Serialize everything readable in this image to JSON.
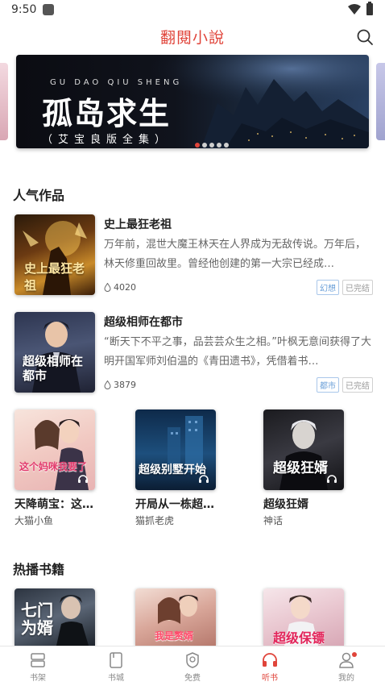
{
  "status_bar": {
    "time": "9:50"
  },
  "header": {
    "title": "翻閱小說",
    "search_icon": "search-icon"
  },
  "banner": {
    "pinyin": "GU DAO QIU SHENG",
    "title": "孤岛求生",
    "subtitle": "（艾宝良版全集）",
    "dot_count": 5,
    "active_dot": 0
  },
  "popular": {
    "section_title": "人气作品",
    "list_books": [
      {
        "name": "史上最狂老祖",
        "description": "万年前，混世大魔王林天在人界成为无敌传说。万年后，林天修重回故里。曾经他创建的第一大宗已经成…",
        "plays": "4020",
        "genre_tag": "幻想",
        "status_tag": "已完结",
        "cover_text": "史上最狂老祖"
      },
      {
        "name": "超级相师在都市",
        "description": "“断天下不平之事，品芸芸众生之相。”叶枫无意间获得了大明开国军师刘伯温的《青田遗书》，凭借着书…",
        "plays": "3879",
        "genre_tag": "都市",
        "status_tag": "已完结",
        "cover_text": "超级相师在都市"
      }
    ],
    "grid_books": [
      {
        "name": "天降萌宝：这…",
        "author": "大猫小鱼",
        "cover_text": "这个妈咪我要了"
      },
      {
        "name": "开局从一栋超…",
        "author": "猫抓老虎",
        "cover_text": "超级别墅开始"
      },
      {
        "name": "超级狂婿",
        "author": "神话",
        "cover_text": "超级狂婿"
      }
    ]
  },
  "hot": {
    "section_title": "热播书籍",
    "books": [
      {
        "cover_text": "七门为婿"
      },
      {
        "cover_text": "我是赘婿"
      },
      {
        "cover_text": "超级保镖"
      }
    ]
  },
  "bottom_nav": [
    {
      "label": "书架",
      "icon": "bookshelf-icon",
      "active": false
    },
    {
      "label": "书城",
      "icon": "bookstore-icon",
      "active": false
    },
    {
      "label": "免费",
      "icon": "free-icon",
      "active": false
    },
    {
      "label": "听书",
      "icon": "headphones-icon",
      "active": true
    },
    {
      "label": "我的",
      "icon": "profile-icon",
      "active": false,
      "badge": true
    }
  ],
  "colors": {
    "accent": "#e0443a",
    "genre_tag": "#6a9fd8"
  }
}
